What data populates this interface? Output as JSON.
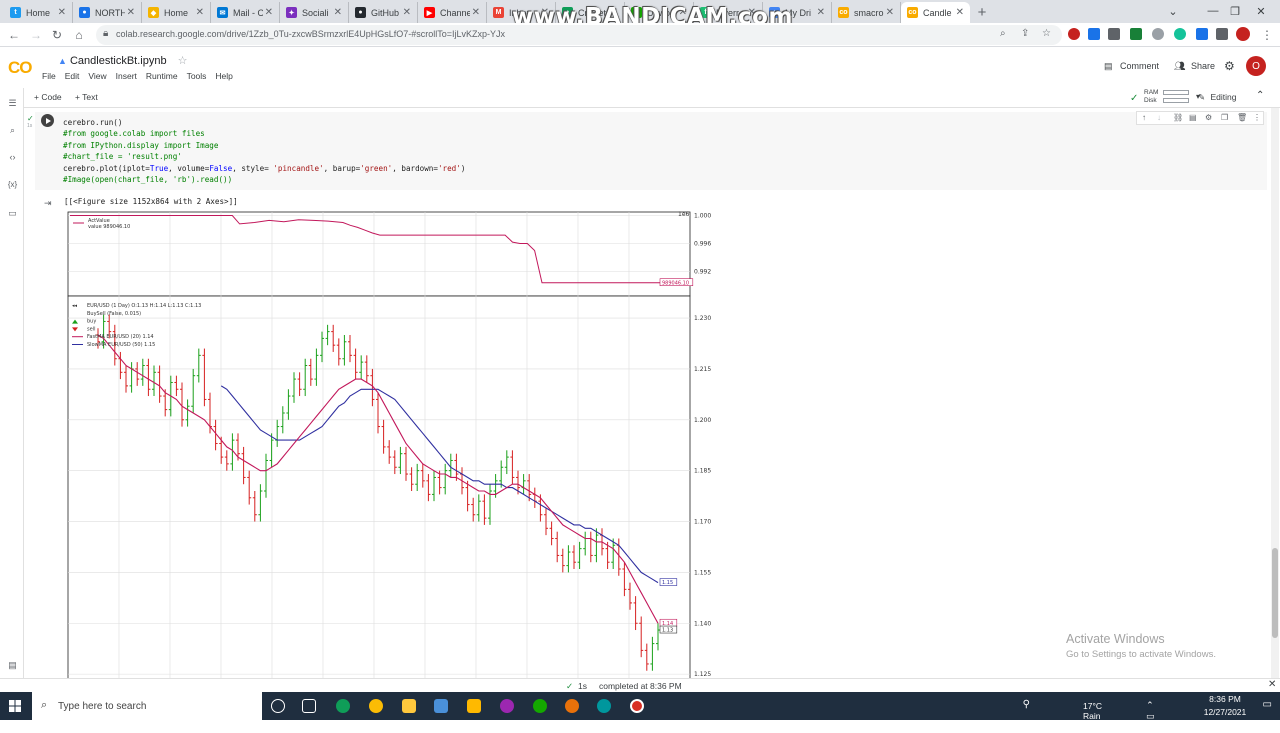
{
  "browser": {
    "tabs": [
      {
        "label": "Home",
        "color": "#1d9bf0",
        "glyph": "t"
      },
      {
        "label": "NORTH",
        "color": "#1a73e8",
        "glyph": "●"
      },
      {
        "label": "Home",
        "color": "#f4b400",
        "glyph": "◆"
      },
      {
        "label": "Mail - O",
        "color": "#0078d4",
        "glyph": "✉"
      },
      {
        "label": "Sociali",
        "color": "#7b2fbe",
        "glyph": "✦"
      },
      {
        "label": "GitHub",
        "color": "#24292f",
        "glyph": "●"
      },
      {
        "label": "Channe",
        "color": "#ff0000",
        "glyph": "▶"
      },
      {
        "label": "Inbox",
        "color": "#ea4335",
        "glyph": "M"
      },
      {
        "label": "Cricket",
        "color": "#0f9d58",
        "glyph": "●"
      },
      {
        "label": "Upwor",
        "color": "#14a800",
        "glyph": "u"
      },
      {
        "label": "Fiverr",
        "color": "#1dbf73",
        "glyph": "f"
      },
      {
        "label": "My Dri",
        "color": "#4285f4",
        "glyph": "▲"
      },
      {
        "label": "smacro",
        "color": "#f9ab00",
        "glyph": "co"
      },
      {
        "label": "Candle",
        "color": "#f9ab00",
        "glyph": "co",
        "active": true
      }
    ],
    "watermark": "www.BANDICAM.com",
    "url": "colab.research.google.com/drive/1Zzb_0Tu-zxcwBSrmzxrlE4UpHGsLfO7-#scrollTo=IjLvKZxp-YJx"
  },
  "colab": {
    "logo": "CO",
    "notebook_title": "CandlestickBt.ipynb",
    "menu": [
      "File",
      "Edit",
      "View",
      "Insert",
      "Runtime",
      "Tools",
      "Help"
    ],
    "comment_label": "Comment",
    "share_label": "Share",
    "avatar_letter": "O",
    "add_code_label": "+ Code",
    "add_text_label": "+ Text",
    "ram_label": "RAM",
    "disk_label": "Disk",
    "editing_label": "Editing"
  },
  "code_cell": {
    "lines": [
      {
        "type": "plain",
        "text": "cerebro.run()"
      },
      {
        "type": "comment",
        "text": "#from google.colab import files"
      },
      {
        "type": "comment",
        "text": "#from IPython.display import Image"
      },
      {
        "type": "comment",
        "text": "#chart_file = 'result.png'"
      },
      {
        "type": "call",
        "text": "cerebro.plot(iplot=True, volume=False, style= 'pincandle', barup='green', bardown='red')"
      },
      {
        "type": "comment",
        "text": "#Image(open(chart_file, 'rb').read())"
      }
    ],
    "output_text": "[[<Figure size 1152x864 with 2 Axes>]]"
  },
  "chart_data": [
    {
      "type": "line",
      "title": "",
      "exponent_label": "1e6",
      "legend": [
        "ActValue",
        "value 989046.10"
      ],
      "yticks": [
        "1.000",
        "0.996",
        "0.992"
      ],
      "ylim": [
        0.9885,
        1.0005
      ],
      "last_value_label": "989046.10",
      "series": [
        {
          "name": "ActValue",
          "color": "#c2185b",
          "x": [
            0,
            22,
            23,
            25,
            27,
            29,
            31,
            33,
            35,
            37,
            38,
            39,
            40,
            41,
            42,
            43,
            59,
            60,
            61,
            62,
            63,
            64,
            80
          ],
          "y": [
            1.0,
            1.0,
            0.9988,
            0.999,
            0.9993,
            0.9991,
            0.9994,
            0.9993,
            0.9992,
            0.999,
            0.9986,
            0.9983,
            0.9979,
            0.9975,
            0.9972,
            0.9972,
            0.9972,
            0.9962,
            0.996,
            0.996,
            0.995,
            0.9904,
            0.9904
          ]
        }
      ]
    },
    {
      "type": "candlestick",
      "legend": [
        "EUR/USD (1 Day) O:1.13 H:1.14 L:1.13 C:1.13",
        "BuySell (False, 0.015)",
        "buy",
        "sell",
        "FastMA EUR/USD (20) 1.14",
        "SlowMA EUR/USD (50) 1.15"
      ],
      "yticks": [
        "1.230",
        "1.215",
        "1.200",
        "1.185",
        "1.170",
        "1.155",
        "1.140",
        "1.125"
      ],
      "ylim": [
        1.1215,
        1.2365
      ],
      "last_labels": {
        "slow": "1.15",
        "fast": "1.14",
        "close": "1.13"
      },
      "close": [
        1.223,
        1.229,
        1.226,
        1.218,
        1.214,
        1.21,
        1.215,
        1.212,
        1.216,
        1.209,
        1.214,
        1.207,
        1.203,
        1.211,
        1.209,
        1.2,
        1.204,
        1.213,
        1.219,
        1.206,
        1.198,
        1.193,
        1.189,
        1.187,
        1.194,
        1.19,
        1.183,
        1.177,
        1.172,
        1.179,
        1.188,
        1.194,
        1.198,
        1.202,
        1.207,
        1.212,
        1.209,
        1.216,
        1.212,
        1.219,
        1.224,
        1.226,
        1.222,
        1.218,
        1.223,
        1.219,
        1.214,
        1.217,
        1.213,
        1.206,
        1.198,
        1.192,
        1.189,
        1.186,
        1.19,
        1.184,
        1.181,
        1.185,
        1.182,
        1.178,
        1.183,
        1.18,
        1.185,
        1.188,
        1.184,
        1.18,
        1.175,
        1.172,
        1.176,
        1.171,
        1.179,
        1.182,
        1.186,
        1.189,
        1.183,
        1.18,
        1.182,
        1.178,
        1.176,
        1.172,
        1.168,
        1.165,
        1.16,
        1.157,
        1.161,
        1.158,
        1.162,
        1.165,
        1.16,
        1.166,
        1.162,
        1.158,
        1.163,
        1.156,
        1.15,
        1.146,
        1.14,
        1.132,
        1.128,
        1.134,
        1.138
      ],
      "fast_ma": [
        1.225,
        1.224,
        1.222,
        1.22,
        1.218,
        1.216,
        1.215,
        1.214,
        1.213,
        1.212,
        1.211,
        1.21,
        1.208,
        1.207,
        1.206,
        1.204,
        1.203,
        1.202,
        1.201,
        1.2,
        1.198,
        1.196,
        1.194,
        1.192,
        1.191,
        1.189,
        1.188,
        1.187,
        1.186,
        1.185,
        1.185,
        1.186,
        1.187,
        1.189,
        1.191,
        1.193,
        1.195,
        1.197,
        1.199,
        1.201,
        1.203,
        1.205,
        1.207,
        1.209,
        1.21,
        1.211,
        1.212,
        1.212,
        1.211,
        1.21,
        1.208,
        1.205,
        1.202,
        1.199,
        1.196,
        1.193,
        1.191,
        1.189,
        1.187,
        1.186,
        1.185,
        1.184,
        1.184,
        1.183,
        1.183,
        1.182,
        1.181,
        1.18,
        1.179,
        1.179,
        1.178,
        1.178,
        1.179,
        1.18,
        1.181,
        1.181,
        1.18,
        1.179,
        1.178,
        1.177,
        1.175,
        1.173,
        1.171,
        1.169,
        1.168,
        1.167,
        1.166,
        1.165,
        1.165,
        1.164,
        1.164,
        1.163,
        1.162,
        1.16,
        1.158,
        1.155,
        1.152,
        1.149,
        1.146,
        1.143,
        1.14
      ],
      "slow_ma": [
        null,
        null,
        null,
        null,
        null,
        null,
        null,
        null,
        null,
        null,
        null,
        null,
        null,
        null,
        null,
        null,
        null,
        null,
        null,
        null,
        null,
        null,
        1.21,
        1.209,
        1.207,
        1.205,
        1.203,
        1.201,
        1.199,
        1.197,
        1.196,
        1.195,
        1.194,
        1.194,
        1.194,
        1.194,
        1.194,
        1.195,
        1.196,
        1.197,
        1.198,
        1.2,
        1.202,
        1.204,
        1.205,
        1.207,
        1.208,
        1.209,
        1.209,
        1.209,
        1.209,
        1.208,
        1.207,
        1.206,
        1.204,
        1.202,
        1.2,
        1.198,
        1.196,
        1.194,
        1.192,
        1.19,
        1.188,
        1.186,
        1.185,
        1.184,
        1.183,
        1.182,
        1.182,
        1.181,
        1.181,
        1.181,
        1.181,
        1.18,
        1.18,
        1.179,
        1.178,
        1.177,
        1.176,
        1.175,
        1.174,
        1.173,
        1.172,
        1.171,
        1.17,
        1.169,
        1.169,
        1.168,
        1.168,
        1.167,
        1.166,
        1.165,
        1.164,
        1.163,
        1.161,
        1.159,
        1.157,
        1.155,
        1.154,
        1.153,
        1.152
      ]
    }
  ],
  "status": {
    "check": "✓",
    "time": "1s",
    "completed": "completed at 8:36 PM"
  },
  "activate_windows": {
    "title": "Activate Windows",
    "subtitle": "Go to Settings to activate Windows."
  },
  "taskbar": {
    "search_placeholder": "Type here to search",
    "weather": "17°C  Rain",
    "time": "8:36 PM",
    "date": "12/27/2021"
  }
}
